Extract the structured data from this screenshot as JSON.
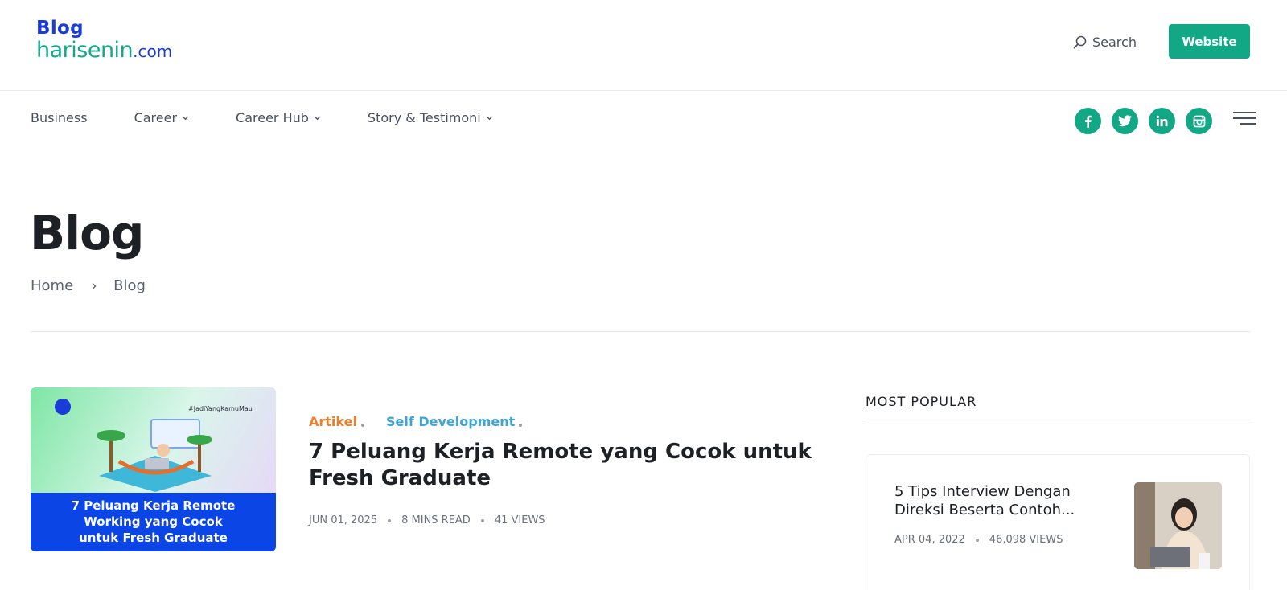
{
  "header": {
    "logo": {
      "line1": "Blog",
      "main": "harisenin",
      "domain": ".com"
    },
    "search_label": "Search",
    "website_button": "Website"
  },
  "nav": {
    "items": [
      {
        "label": "Business",
        "has_dropdown": false
      },
      {
        "label": "Career",
        "has_dropdown": true
      },
      {
        "label": "Career Hub",
        "has_dropdown": true
      },
      {
        "label": "Story & Testimoni",
        "has_dropdown": true
      }
    ],
    "social_icons": [
      "facebook-icon",
      "twitter-icon",
      "linkedin-icon",
      "instagram-icon"
    ]
  },
  "page": {
    "title": "Blog",
    "breadcrumb": [
      "Home",
      "Blog"
    ]
  },
  "featured_post": {
    "thumbnail_caption": "7 Peluang Kerja Remote\nWorking yang Cocok\nuntuk Fresh Graduate",
    "thumbnail_hashtag": "#JadiYangKamuMau",
    "categories": [
      "Artikel",
      "Self Development"
    ],
    "title": "7 Peluang Kerja Remote yang Cocok untuk Fresh Graduate",
    "date": "JUN 01, 2025",
    "read_time": "8 MINS READ",
    "views": "41 VIEWS"
  },
  "sidebar": {
    "heading": "MOST POPULAR",
    "popular": [
      {
        "title": "5 Tips Interview Dengan Direksi Beserta Contoh...",
        "date": "APR 04, 2022",
        "views": "46,098 VIEWS"
      }
    ]
  },
  "colors": {
    "brand_green": "#12a886",
    "brand_blue": "#1a3dd9",
    "category_orange": "#e8822e",
    "category_blue": "#3ea5d4"
  }
}
